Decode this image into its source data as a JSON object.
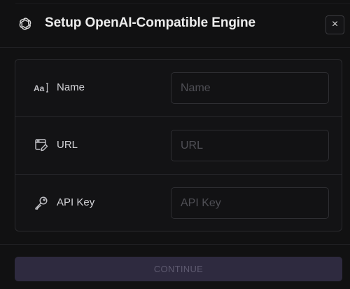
{
  "dialog": {
    "title": "Setup OpenAI-Compatible Engine",
    "title_icon": "openai-icon",
    "close_label": "×"
  },
  "form": {
    "fields": [
      {
        "icon": "text-size-icon",
        "icon_text": "Aa",
        "label": "Name",
        "placeholder": "Name",
        "value": ""
      },
      {
        "icon": "browser-edit-icon",
        "label": "URL",
        "placeholder": "URL",
        "value": ""
      },
      {
        "icon": "key-icon",
        "label": "API Key",
        "placeholder": "API Key",
        "value": ""
      }
    ]
  },
  "actions": {
    "continue_label": "CONTINUE"
  },
  "colors": {
    "background": "#111112",
    "border": "#2a2a2d",
    "button_disabled_bg": "#2e2a3f",
    "button_disabled_text": "#5e5a70"
  }
}
